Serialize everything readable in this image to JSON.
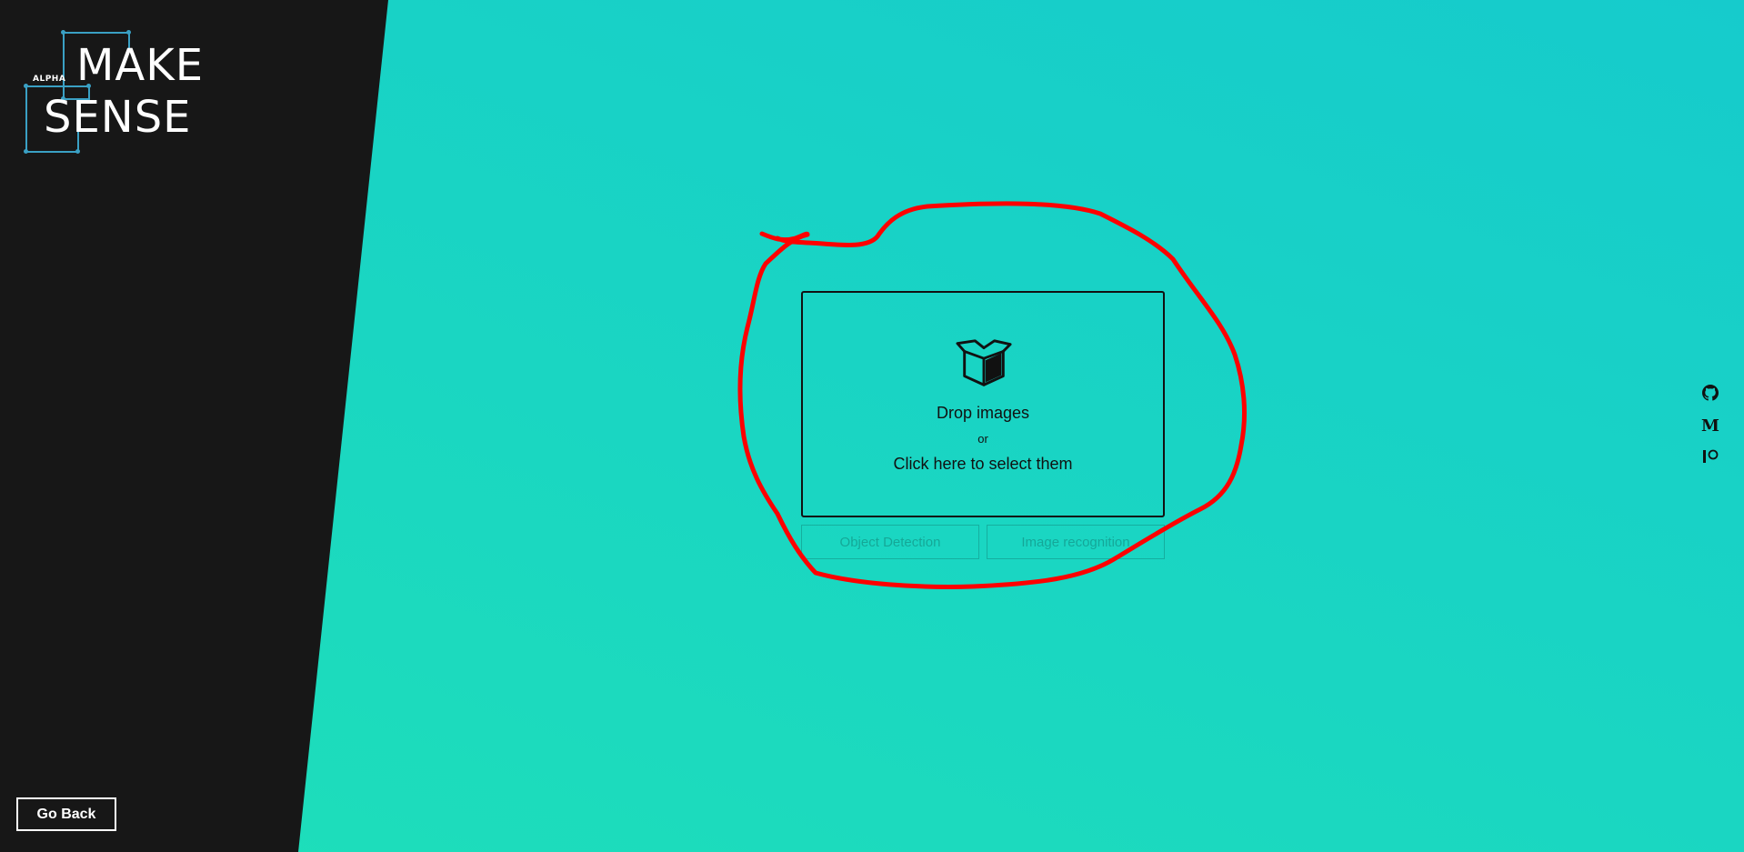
{
  "logo": {
    "alpha_label": "ALPHA",
    "word_top": "MAKE",
    "word_bottom": "SENSE"
  },
  "sidebar": {
    "go_back_label": "Go Back"
  },
  "dropzone": {
    "icon": "box-icon",
    "title": "Drop images",
    "or": "or",
    "subtitle": "Click here to select them"
  },
  "mode_buttons": {
    "object_detection": "Object Detection",
    "image_recognition": "Image recognition"
  },
  "social": {
    "github": "github-icon",
    "medium_glyph": "M",
    "patreon": "patreon-icon"
  },
  "colors": {
    "panel": "#171717",
    "accent": "#3aa0c4",
    "background_top": "#16cbcc",
    "background_bottom": "#1edfb9",
    "annotation": "#ff0000"
  }
}
